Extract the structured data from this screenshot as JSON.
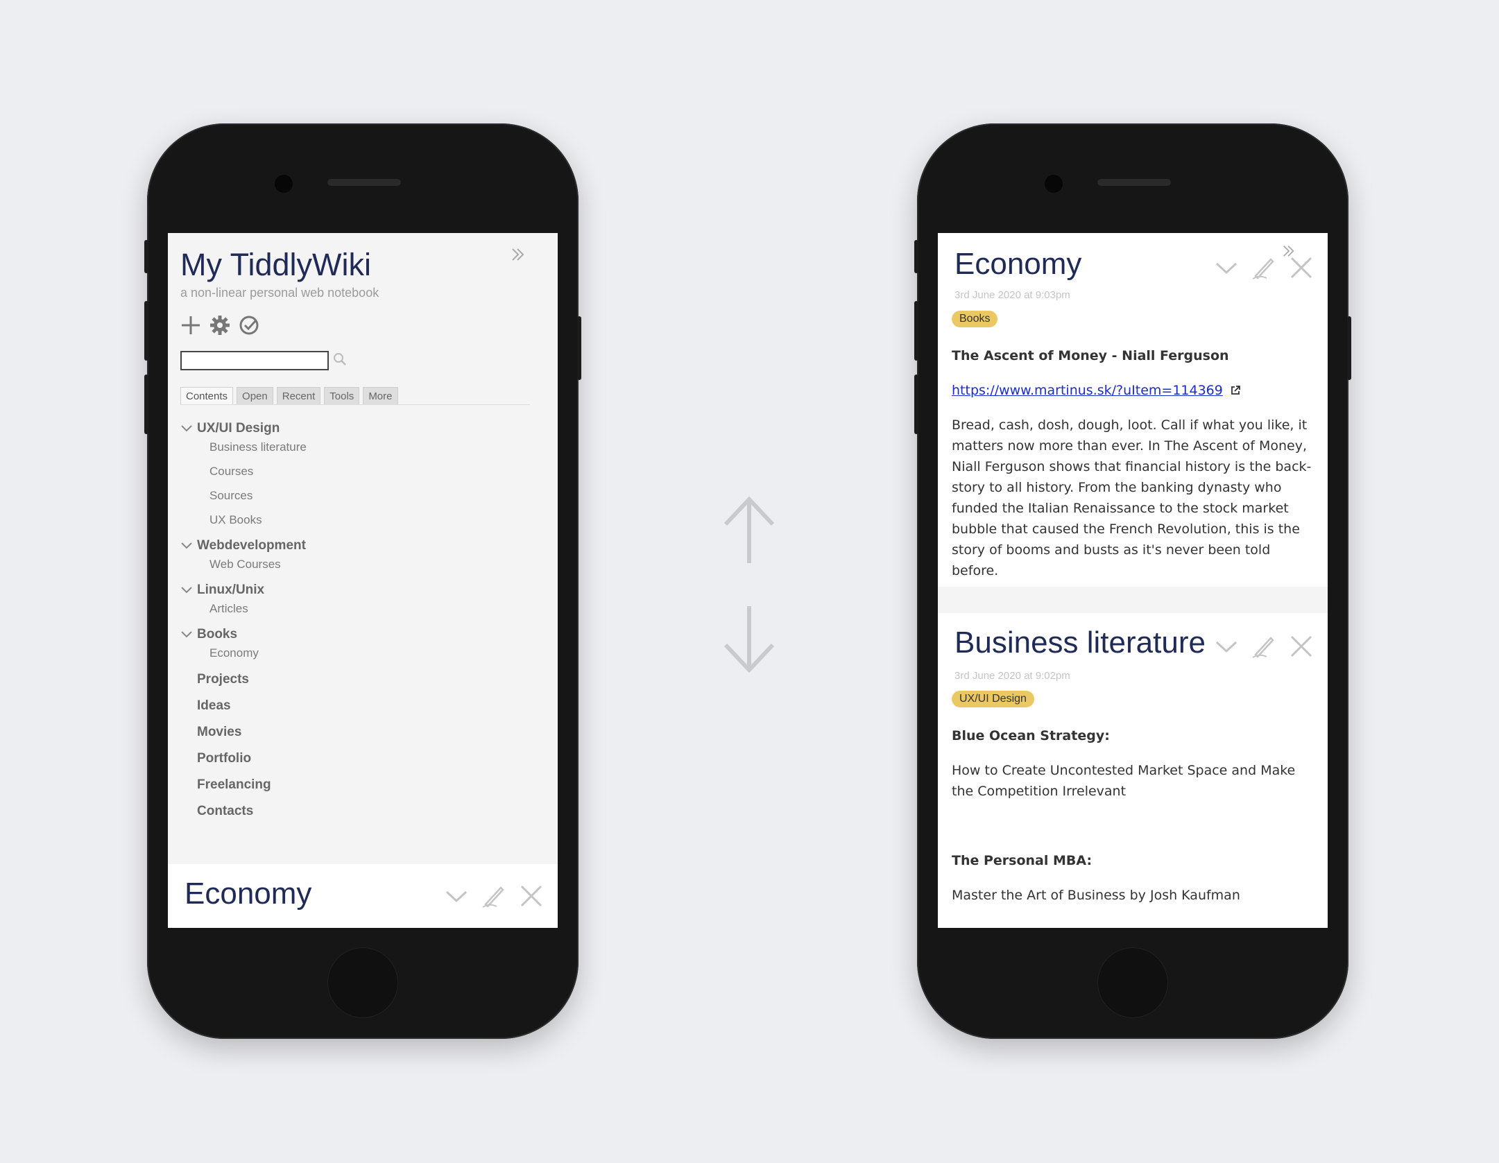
{
  "left_phone": {
    "wiki_title": "My TiddlyWiki",
    "wiki_subtitle": "a non-linear personal web notebook",
    "search_placeholder": "",
    "tabs": [
      "Contents",
      "Open",
      "Recent",
      "Tools",
      "More"
    ],
    "toc": {
      "groups": [
        {
          "label": "UX/UI Design",
          "children": [
            "Business literature",
            "Courses",
            "Sources",
            "UX Books"
          ]
        },
        {
          "label": "Webdevelopment",
          "children": [
            "Web Courses"
          ]
        },
        {
          "label": "Linux/Unix",
          "children": [
            "Articles"
          ]
        },
        {
          "label": "Books",
          "children": [
            "Economy"
          ]
        }
      ],
      "plain": [
        "Projects",
        "Ideas",
        "Movies",
        "Portfolio",
        "Freelancing",
        "Contacts"
      ]
    },
    "peek_title": "Economy"
  },
  "right_phone": {
    "tiddler1": {
      "title": "Economy",
      "date": "3rd June 2020 at 9:03pm",
      "tag": "Books",
      "heading": "The Ascent of Money - Niall Ferguson",
      "link": "https://www.martinus.sk/?uItem=114369",
      "body": "Bread, cash, dosh, dough, loot. Call if what you like, it matters now more than ever. In The Ascent of Money, Niall Ferguson shows that financial history is the back-story to all history. From the banking dynasty who funded the Italian Renaissance to the stock market bubble that caused the French Revolution, this is the story of booms and busts as it's never been told before."
    },
    "tiddler2": {
      "title": "Business literature",
      "date": "3rd June 2020 at 9:02pm",
      "tag": "UX/UI Design",
      "heading1": "Blue Ocean Strategy:",
      "text1": "How to Create Uncontested Market Space and Make the Competition Irrelevant",
      "heading2": "The Personal MBA:",
      "text2": "Master the Art of Business by Josh Kaufman"
    }
  },
  "icons": {
    "close": "close-icon",
    "edit": "edit-pencil-icon",
    "fold": "chevron-down-icon",
    "sidebar_toggle": "double-chevron-right-icon",
    "new": "plus-icon",
    "settings": "gear-icon",
    "done": "check-circle-icon",
    "search": "search-icon",
    "external": "external-link-icon"
  },
  "colors": {
    "background": "#edeef1",
    "phone": "#161616",
    "title": "#1f2a56",
    "tag": "#ebc862",
    "link": "#1c2bc9"
  }
}
